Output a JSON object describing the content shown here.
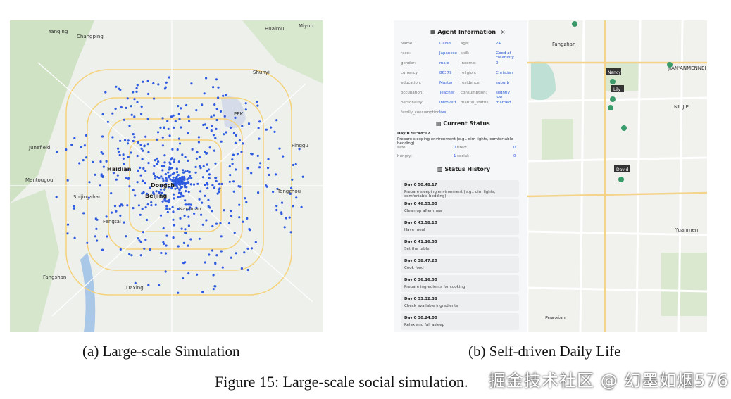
{
  "captions": {
    "a": "(a) Large-scale Simulation",
    "b": "(b) Self-driven Daily Life",
    "figure": "Figure 15: Large-scale social simulation."
  },
  "watermark": "掘金技术社区 @ 幻墨如烟576",
  "map_a": {
    "labels": [
      "Changping",
      "Shunyi",
      "Haidian",
      "Dongch",
      "Beijing",
      "Tongzhou",
      "Fengtai",
      "Daxing",
      "Fangshan",
      "Mentougou",
      "Shijingshan",
      "Nanhuan",
      "PEK",
      "Yanqing",
      "Junefield",
      "Huairou",
      "Miyun",
      "Pinggu"
    ]
  },
  "map_b": {
    "agents": [
      "Nancy",
      "Lily",
      "David"
    ],
    "road_labels": [
      "JIAN'ANMENNEI",
      "NIUJIE",
      "Fangzhan",
      "Yuanmen",
      "Fuwaiao"
    ]
  },
  "agent_info": {
    "title": "Agent Information",
    "close": "×",
    "fields": [
      {
        "k": "Name:",
        "v": "David",
        "k2": "age:",
        "v2": "24"
      },
      {
        "k": "race:",
        "v": "Japanese",
        "k2": "skill:",
        "v2": "Good at creativity"
      },
      {
        "k": "gender:",
        "v": "male",
        "k2": "income:",
        "v2": "0"
      },
      {
        "k": "currency:",
        "v": "86379",
        "k2": "religion:",
        "v2": "Christian"
      },
      {
        "k": "education:",
        "v": "Master",
        "k2": "residence:",
        "v2": "suburb"
      },
      {
        "k": "occupation:",
        "v": "Teacher",
        "k2": "consumption:",
        "v2": "slightly low"
      },
      {
        "k": "personality:",
        "v": "introvert",
        "k2": "marital_status:",
        "v2": "married"
      },
      {
        "k": "family_consumption:",
        "v": "low",
        "k2": "",
        "v2": ""
      }
    ],
    "current_status": {
      "title": "Current Status",
      "time": "Day 0 50:48:17",
      "desc": "Prepare sleeping environment (e.g., dim lights, comfortable bedding)",
      "metrics": [
        {
          "k": "safe:",
          "v": "0",
          "k2": "tired:",
          "v2": "0"
        },
        {
          "k": "hungry:",
          "v": "1",
          "k2": "social:",
          "v2": "0"
        }
      ]
    },
    "status_history": {
      "title": "Status History",
      "items": [
        {
          "t": "Day 0 50:48:17",
          "d": "Prepare sleeping environment (e.g., dim lights, comfortable bedding)"
        },
        {
          "t": "Day 0 46:55:00",
          "d": "Clean up after meal"
        },
        {
          "t": "Day 0 43:58:10",
          "d": "Have meal"
        },
        {
          "t": "Day 0 41:16:55",
          "d": "Set the table"
        },
        {
          "t": "Day 0 38:47:20",
          "d": "Cook food"
        },
        {
          "t": "Day 0 36:16:50",
          "d": "Prepare ingredients for cooking"
        },
        {
          "t": "Day 0 33:32:38",
          "d": "Check available ingredients"
        },
        {
          "t": "Day 0 30:24:00",
          "d": "Relax and fall asleep"
        }
      ]
    }
  }
}
